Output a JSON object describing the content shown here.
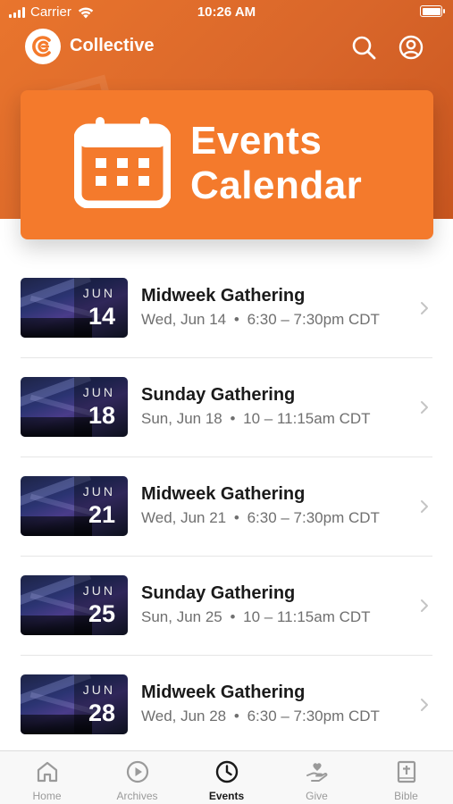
{
  "status_bar": {
    "carrier": "Carrier",
    "time": "10:26 AM",
    "battery_level": 1.0
  },
  "header": {
    "app_name": "Collective",
    "logo_icon": "collective-logo-icon",
    "search_icon": "search-icon",
    "profile_icon": "profile-icon"
  },
  "hero": {
    "title_line1": "Events",
    "title_line2": "Calendar",
    "icon": "calendar-icon",
    "background_color": "#f47a2c"
  },
  "events": [
    {
      "title": "Midweek Gathering",
      "month": "JUN",
      "day": "14",
      "date_text": "Wed, Jun 14",
      "time_text": "6:30 – 7:30pm CDT"
    },
    {
      "title": "Sunday Gathering",
      "month": "JUN",
      "day": "18",
      "date_text": "Sun, Jun 18",
      "time_text": "10 – 11:15am CDT"
    },
    {
      "title": "Midweek Gathering",
      "month": "JUN",
      "day": "21",
      "date_text": "Wed, Jun 21",
      "time_text": "6:30 – 7:30pm CDT"
    },
    {
      "title": "Sunday Gathering",
      "month": "JUN",
      "day": "25",
      "date_text": "Sun, Jun 25",
      "time_text": "10 – 11:15am CDT"
    },
    {
      "title": "Midweek Gathering",
      "month": "JUN",
      "day": "28",
      "date_text": "Wed, Jun 28",
      "time_text": "6:30 – 7:30pm CDT"
    }
  ],
  "meta_separator": "•",
  "tabs": [
    {
      "label": "Home",
      "icon": "home-icon",
      "active": false
    },
    {
      "label": "Archives",
      "icon": "play-icon",
      "active": false
    },
    {
      "label": "Events",
      "icon": "clock-icon",
      "active": true
    },
    {
      "label": "Give",
      "icon": "give-icon",
      "active": false
    },
    {
      "label": "Bible",
      "icon": "bible-icon",
      "active": false
    }
  ],
  "colors": {
    "accent": "#f47a2c",
    "header_bg": "#e06e2b",
    "tab_active": "#1a1a1a",
    "tab_inactive": "#9a9a9a"
  }
}
